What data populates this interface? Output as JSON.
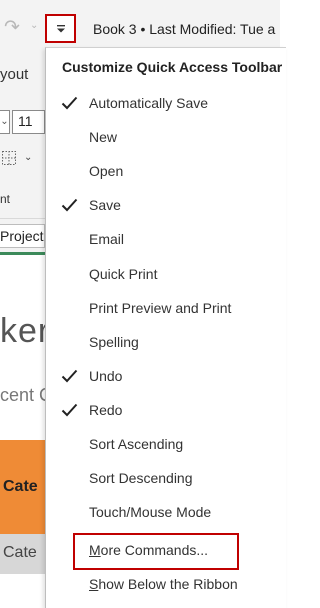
{
  "title_bar": {
    "document_title": "Book 3 • Last Modified: Tue a",
    "redo_icon": "redo-icon",
    "qat_icon": "customize-dropdown-icon"
  },
  "ribbon": {
    "tab_partial": "yout",
    "font_size": "11",
    "group_label_partial": "nt"
  },
  "sheet": {
    "tab_partial": "Project",
    "title_partial": "ker",
    "subtitle_partial": "cent C",
    "cell_orange": "Cate",
    "cell_gray": "Cate"
  },
  "menu": {
    "title": "Customize Quick Access Toolbar",
    "items": [
      {
        "label": "Automatically Save",
        "checked": true
      },
      {
        "label": "New",
        "checked": false
      },
      {
        "label": "Open",
        "checked": false
      },
      {
        "label": "Save",
        "checked": true
      },
      {
        "label": "Email",
        "checked": false
      },
      {
        "label": "Quick Print",
        "checked": false
      },
      {
        "label": "Print Preview and Print",
        "checked": false
      },
      {
        "label": "Spelling",
        "checked": false
      },
      {
        "label": "Undo",
        "checked": true
      },
      {
        "label": "Redo",
        "checked": true
      },
      {
        "label": "Sort Ascending",
        "checked": false
      },
      {
        "label": "Sort Descending",
        "checked": false
      },
      {
        "label": "Touch/Mouse Mode",
        "checked": false
      }
    ],
    "more_commands": {
      "first": "M",
      "rest": "ore Commands..."
    },
    "show_below": {
      "first": "S",
      "rest": "how Below the Ribbon"
    }
  },
  "colors": {
    "highlight": "#c00000",
    "orange": "#ef8b36",
    "green": "#3c8a5a"
  }
}
